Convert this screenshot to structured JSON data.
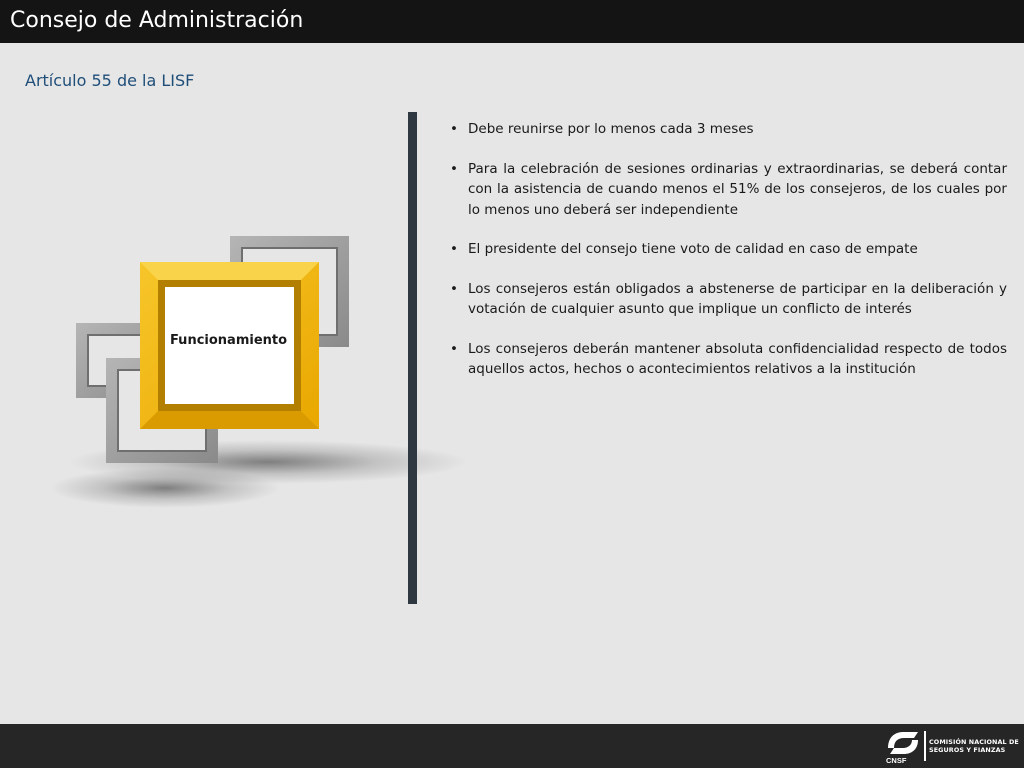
{
  "header": {
    "title": "Consejo de Administración"
  },
  "subtitle": "Artículo 55 de la LISF",
  "diagram": {
    "center_label": "Funcionamiento"
  },
  "bullets": [
    "Debe reunirse por lo menos cada 3 meses",
    "Para la celebración de sesiones ordinarias y extraordinarias, se deberá contar con la asistencia de cuando menos el 51% de los consejeros, de los cuales por lo menos uno deberá ser independiente",
    "El presidente del consejo tiene voto de calidad en caso de empate",
    "Los consejeros están obligados a abstenerse de participar en la deliberación y votación de cualquier asunto que implique un conflicto de interés",
    "Los consejeros deberán mantener absoluta confidencialidad respecto de todos aquellos actos, hechos o acontecimientos relativos a la institución"
  ],
  "bullet_symbol": "•",
  "footer": {
    "logo": {
      "acronym": "CNSF",
      "line1": "COMISIÓN NACIONAL DE",
      "line2": "SEGUROS Y FIANZAS"
    }
  },
  "colors": {
    "title_bar": "#141414",
    "background": "#e6e6e6",
    "subtitle": "#1f4e79",
    "accent_frame": "#f2b80f",
    "gray_frame": "#9a9a9a",
    "divider": "#2f3840",
    "footer_bar": "#262626"
  },
  "icons": {
    "logo": "cnsf-logo-icon"
  }
}
